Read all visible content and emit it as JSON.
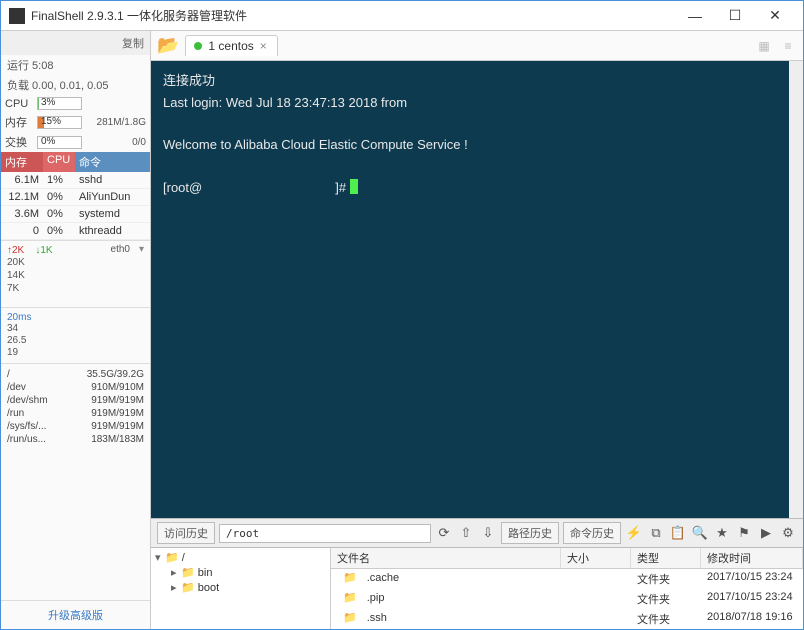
{
  "titlebar": {
    "title": "FinalShell 2.9.3.1 一体化服务器管理软件"
  },
  "sidebar": {
    "copy_label": "复制",
    "uptime": "运行 5:08",
    "load": "负载 0.00, 0.01, 0.05",
    "cpu": {
      "label": "CPU",
      "pct": "3%",
      "fill": 3,
      "color": "#6fbf6f",
      "val": ""
    },
    "mem": {
      "label": "内存",
      "pct": "15%",
      "fill": 15,
      "color": "#e07b3a",
      "val": "281M/1.8G"
    },
    "swap": {
      "label": "交换",
      "pct": "0%",
      "fill": 0,
      "color": "#ccc",
      "val": "0/0"
    },
    "proc_header": {
      "c1": "内存",
      "c2": "CPU",
      "c3": "命令"
    },
    "procs": [
      {
        "mem": "6.1M",
        "cpu": "1%",
        "cmd": "sshd"
      },
      {
        "mem": "12.1M",
        "cpu": "0%",
        "cmd": "AliYunDun"
      },
      {
        "mem": "3.6M",
        "cpu": "0%",
        "cmd": "systemd"
      },
      {
        "mem": "0",
        "cpu": "0%",
        "cmd": "kthreadd"
      }
    ],
    "net": {
      "up_label": "↑2K",
      "down_label": "↓1K",
      "ifname": "eth0",
      "y": [
        "20K",
        "14K",
        "7K"
      ]
    },
    "ping": {
      "hdr": "20ms",
      "y": [
        "34",
        "26.5",
        "19"
      ]
    },
    "disks": [
      {
        "p": "/",
        "v": "35.5G/39.2G"
      },
      {
        "p": "/dev",
        "v": "910M/910M"
      },
      {
        "p": "/dev/shm",
        "v": "919M/919M"
      },
      {
        "p": "/run",
        "v": "919M/919M"
      },
      {
        "p": "/sys/fs/...",
        "v": "919M/919M"
      },
      {
        "p": "/run/us...",
        "v": "183M/183M"
      }
    ],
    "upgrade": "升级高级版"
  },
  "tab": {
    "label": "1 centos"
  },
  "terminal": {
    "line1": "连接成功",
    "line2": "Last login: Wed Jul 18 23:47:13 2018 from",
    "line3": "Welcome to Alibaba Cloud Elastic Compute Service !",
    "prompt_pre": "[root@",
    "prompt_post": "]# "
  },
  "termbar": {
    "history": "访问历史",
    "path": "/root",
    "path_history": "路径历史",
    "cmd_history": "命令历史"
  },
  "tree": {
    "root": "/",
    "children": [
      "bin",
      "boot"
    ]
  },
  "filelist": {
    "cols": {
      "name": "文件名",
      "size": "大小",
      "type": "类型",
      "mtime": "修改时间"
    },
    "rows": [
      {
        "name": ".cache",
        "size": "",
        "type": "文件夹",
        "mtime": "2017/10/15 23:24"
      },
      {
        "name": ".pip",
        "size": "",
        "type": "文件夹",
        "mtime": "2017/10/15 23:24"
      },
      {
        "name": ".ssh",
        "size": "",
        "type": "文件夹",
        "mtime": "2018/07/18 19:16"
      }
    ]
  }
}
